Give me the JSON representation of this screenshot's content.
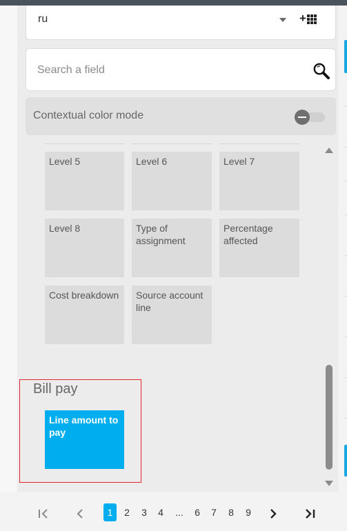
{
  "language": {
    "value": "ru"
  },
  "search": {
    "placeholder": "Search a field"
  },
  "contextual_color_mode": {
    "label": "Contextual color mode",
    "enabled": false
  },
  "fields": [
    {
      "label": "Level 5"
    },
    {
      "label": "Level 6"
    },
    {
      "label": "Level 7"
    },
    {
      "label": "Level 8"
    },
    {
      "label": "Type of assignment"
    },
    {
      "label": "Percentage affected"
    },
    {
      "label": "Cost breakdown"
    },
    {
      "label": "Source account line"
    }
  ],
  "bill_pay": {
    "title": "Bill pay",
    "fields": [
      {
        "label": "Line amount to pay",
        "selected": true
      }
    ]
  },
  "pagination": {
    "current": "1",
    "pages": [
      "1",
      "2",
      "3",
      "4",
      "...",
      "6",
      "7",
      "8",
      "9"
    ]
  },
  "colors": {
    "accent": "#00aeef",
    "highlight_border": "#e0262b",
    "tile": "#dcdcdc"
  },
  "icons": {
    "language_dropdown": "chevron-down-icon",
    "add_grid": "add-grid-icon",
    "search": "magnifier-icon",
    "toggle": "toggle-off-icon",
    "first_page": "first-page-icon",
    "prev_page": "chevron-left-icon",
    "next_page": "chevron-right-icon",
    "last_page": "last-page-icon"
  }
}
